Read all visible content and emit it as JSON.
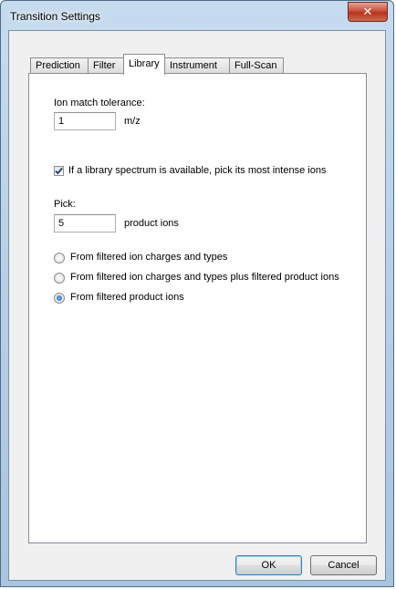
{
  "window": {
    "title": "Transition Settings",
    "close_glyph": "✕"
  },
  "tabs": [
    {
      "label": "Prediction",
      "active": false
    },
    {
      "label": "Filter",
      "active": false
    },
    {
      "label": "Library",
      "active": true
    },
    {
      "label": "Instrument",
      "active": false
    },
    {
      "label": "Full-Scan",
      "active": false
    }
  ],
  "library": {
    "ion_match_tolerance_label": "Ion match tolerance:",
    "ion_match_tolerance_value": "1",
    "ion_match_tolerance_unit": "m/z",
    "pick_intense_ions_checkbox": {
      "label": "If a library spectrum is available, pick its most intense ions",
      "checked": true
    },
    "pick_label": "Pick:",
    "pick_value": "5",
    "pick_unit": "product ions",
    "radio_options": [
      {
        "label": "From filtered ion charges and types",
        "selected": false
      },
      {
        "label": "From filtered ion charges and types plus filtered product ions",
        "selected": false
      },
      {
        "label": "From filtered product ions",
        "selected": true
      }
    ]
  },
  "buttons": {
    "ok": "OK",
    "cancel": "Cancel"
  }
}
